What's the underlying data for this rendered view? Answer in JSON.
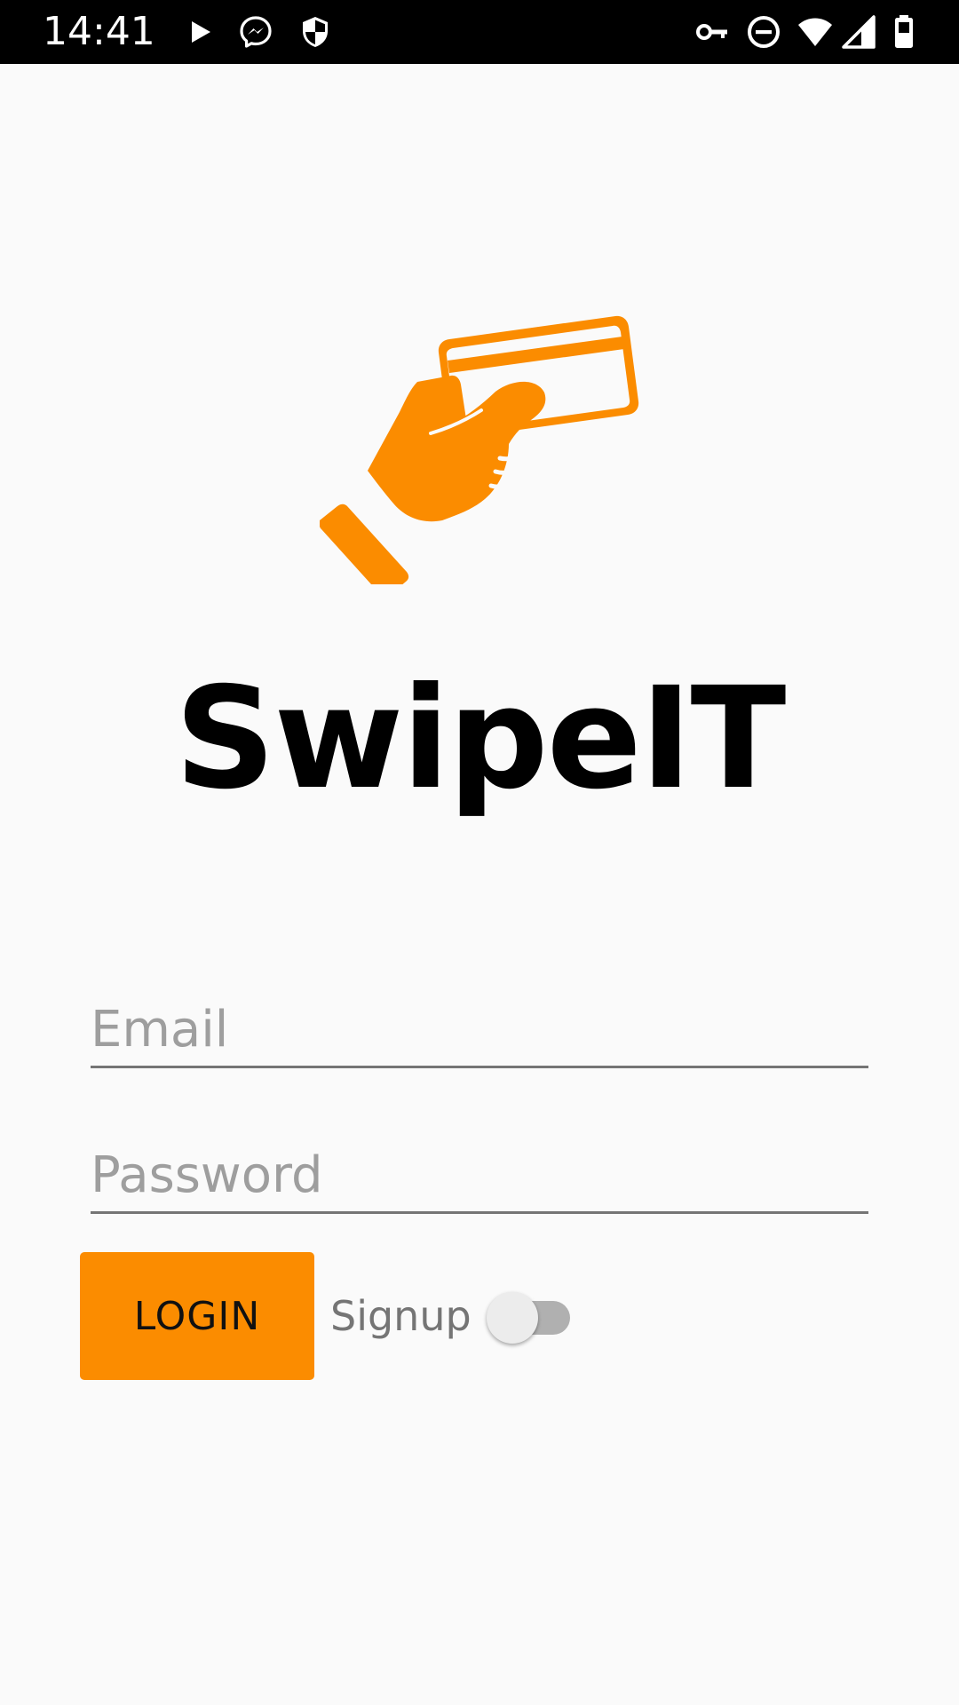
{
  "status_bar": {
    "time": "14:41",
    "left_icons": [
      "play-icon",
      "messenger-icon",
      "shield-icon"
    ],
    "right_icons": [
      "vpn-key-icon",
      "do-not-disturb-icon",
      "wifi-icon",
      "signal-icon",
      "battery-icon"
    ]
  },
  "app": {
    "logo_icon": "hand-holding-card-icon",
    "title": "SwipeIT",
    "accent_color": "#fb8c00"
  },
  "form": {
    "email": {
      "value": "",
      "placeholder": "Email"
    },
    "password": {
      "value": "",
      "placeholder": "Password"
    },
    "login_label": "LOGIN",
    "signup_label": "Signup",
    "signup_toggle_on": false
  }
}
